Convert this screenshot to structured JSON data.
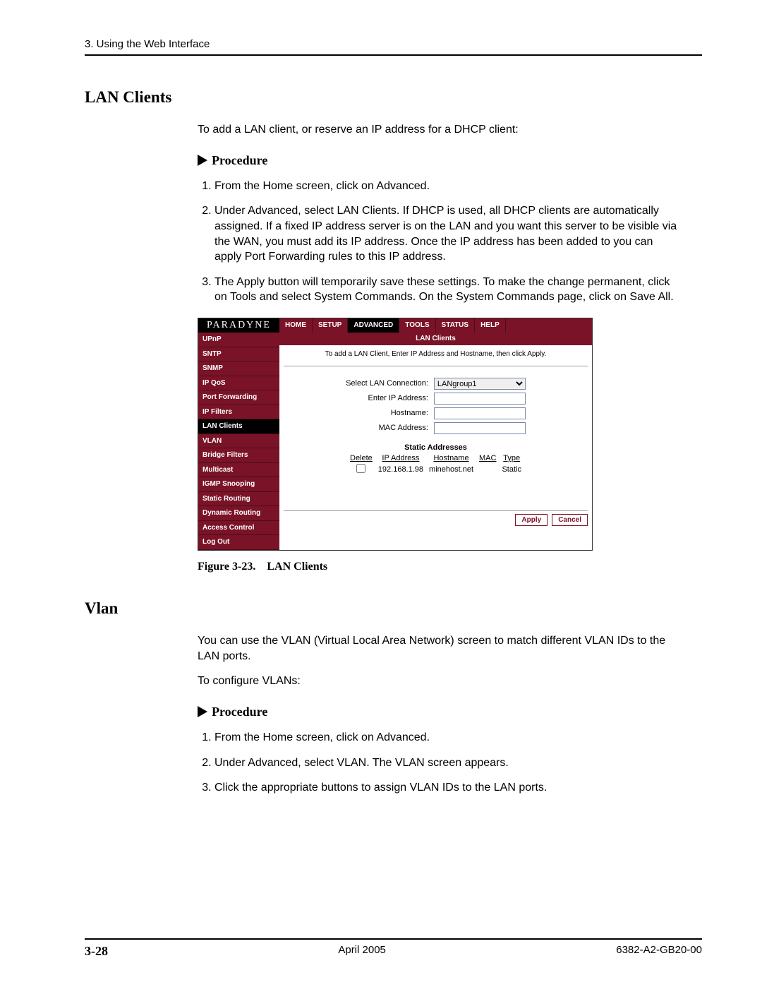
{
  "header": {
    "chapter": "3. Using the Web Interface"
  },
  "section1": {
    "title": "LAN Clients",
    "intro": "To add a LAN client, or reserve an IP address for a DHCP client:",
    "proc_label": "Procedure",
    "steps": {
      "s1": "From the Home screen, click on Advanced.",
      "s2": "Under Advanced, select LAN Clients. If DHCP is used, all DHCP clients are automatically assigned. If a fixed IP address server is on the LAN and you want this server to be visible via the WAN, you must add its IP address. Once the IP address has been added to you can apply Port Forwarding rules to this IP address.",
      "s3": "The Apply button will temporarily save these settings. To make the change permanent, click on Tools and select System Commands. On the System Commands page, click on Save All."
    }
  },
  "figure": {
    "logo": "PARADYNE",
    "topnav": [
      "HOME",
      "SETUP",
      "ADVANCED",
      "TOOLS",
      "STATUS",
      "HELP"
    ],
    "leftnav": [
      "UPnP",
      "SNTP",
      "SNMP",
      "IP QoS",
      "Port Forwarding",
      "IP Filters",
      "LAN Clients",
      "VLAN",
      "Bridge Filters",
      "Multicast",
      "IGMP Snooping",
      "Static Routing",
      "Dynamic Routing",
      "Access Control",
      "Log Out"
    ],
    "content": {
      "title": "LAN Clients",
      "hint": "To add a LAN Client, Enter IP Address and Hostname, then click Apply.",
      "labels": {
        "conn": "Select LAN Connection:",
        "ip": "Enter IP Address:",
        "host": "Hostname:",
        "mac": "MAC Address:"
      },
      "conn_value": "LANgroup1",
      "static_title": "Static Addresses",
      "cols": [
        "Delete",
        "IP Address",
        "Hostname",
        "MAC",
        "Type"
      ],
      "row": {
        "ip": "192.168.1.98",
        "host": "minehost.net",
        "mac": "",
        "type": "Static"
      },
      "apply": "Apply",
      "cancel": "Cancel"
    },
    "caption": "Figure 3-23. LAN Clients"
  },
  "section2": {
    "title": "Vlan",
    "p1": "You can use the VLAN (Virtual Local Area Network) screen to match different VLAN IDs to the LAN ports.",
    "p2": "To configure VLANs:",
    "proc_label": "Procedure",
    "steps": {
      "s1": "From the Home screen, click on Advanced.",
      "s2": "Under Advanced, select VLAN. The VLAN screen appears.",
      "s3": "Click the appropriate buttons to assign VLAN IDs to the LAN ports."
    }
  },
  "footer": {
    "page": "3-28",
    "date": "April 2005",
    "doc": "6382-A2-GB20-00"
  }
}
